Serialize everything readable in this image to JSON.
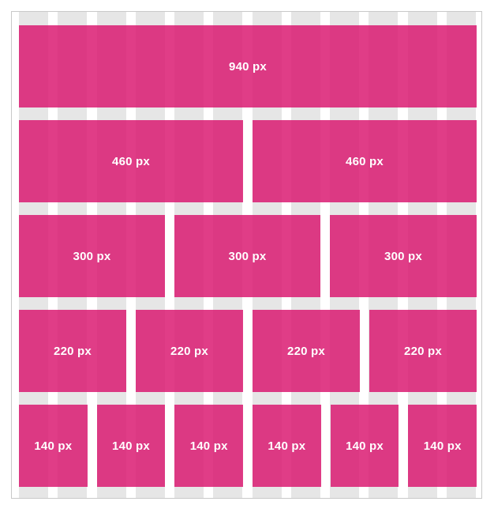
{
  "grid": {
    "columns": 12,
    "accent_color": "#d9126d",
    "background_column_color": "#e6e6e6"
  },
  "rows": [
    {
      "blocks": [
        {
          "label": "940 px"
        }
      ]
    },
    {
      "blocks": [
        {
          "label": "460 px"
        },
        {
          "label": "460 px"
        }
      ]
    },
    {
      "blocks": [
        {
          "label": "300 px"
        },
        {
          "label": "300 px"
        },
        {
          "label": "300 px"
        }
      ]
    },
    {
      "blocks": [
        {
          "label": "220 px"
        },
        {
          "label": "220 px"
        },
        {
          "label": "220 px"
        },
        {
          "label": "220 px"
        }
      ]
    },
    {
      "blocks": [
        {
          "label": "140 px"
        },
        {
          "label": "140 px"
        },
        {
          "label": "140 px"
        },
        {
          "label": "140 px"
        },
        {
          "label": "140 px"
        },
        {
          "label": "140 px"
        }
      ]
    }
  ]
}
